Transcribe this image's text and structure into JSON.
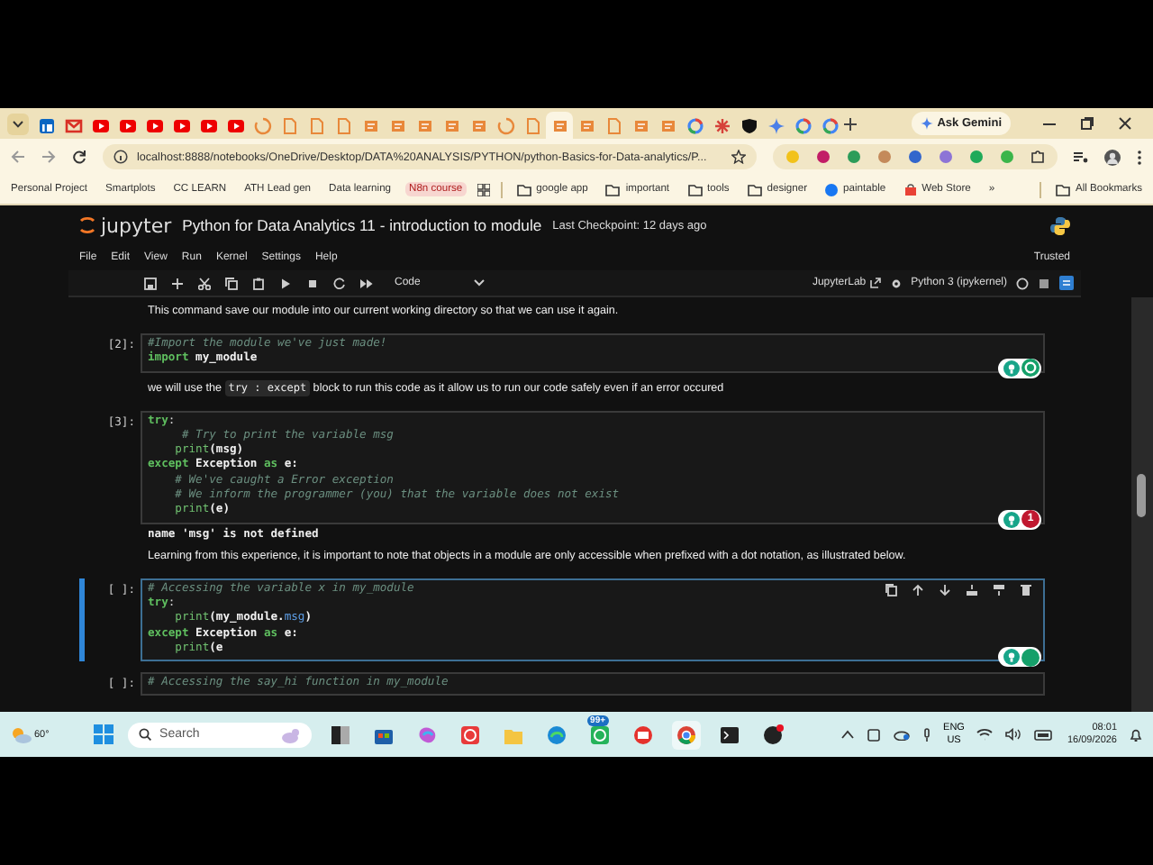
{
  "browser_tabs": [
    {
      "kind": "tile",
      "selected": false
    },
    {
      "kind": "mail",
      "selected": false
    },
    {
      "kind": "video",
      "selected": false
    },
    {
      "kind": "video",
      "selected": false
    },
    {
      "kind": "video",
      "selected": false
    },
    {
      "kind": "video",
      "selected": false
    },
    {
      "kind": "video",
      "selected": false
    },
    {
      "kind": "video",
      "selected": false
    },
    {
      "kind": "spinner",
      "selected": false
    },
    {
      "kind": "page",
      "selected": false
    },
    {
      "kind": "page",
      "selected": false
    },
    {
      "kind": "page",
      "selected": false
    },
    {
      "kind": "notebook",
      "selected": false
    },
    {
      "kind": "notebook",
      "selected": false
    },
    {
      "kind": "notebook",
      "selected": false
    },
    {
      "kind": "notebook",
      "selected": false
    },
    {
      "kind": "notebook",
      "selected": false
    },
    {
      "kind": "spinner",
      "selected": false
    },
    {
      "kind": "page",
      "selected": false
    },
    {
      "kind": "notebook",
      "selected": true
    },
    {
      "kind": "notebook",
      "selected": false
    },
    {
      "kind": "page",
      "selected": false
    },
    {
      "kind": "notebook",
      "selected": false
    },
    {
      "kind": "notebook",
      "selected": false
    },
    {
      "kind": "ring",
      "selected": false
    },
    {
      "kind": "burst",
      "selected": false
    },
    {
      "kind": "shield",
      "selected": false
    },
    {
      "kind": "sparkle",
      "selected": false
    },
    {
      "kind": "ring",
      "selected": false
    },
    {
      "kind": "ring",
      "selected": false
    }
  ],
  "ask_gemini": "Ask Gemini",
  "address_bar": {
    "url": "localhost:8888/notebooks/OneDrive/Desktop/DATA%20ANALYSIS/PYTHON/python-Basics-for-Data-analytics/P..."
  },
  "bookmarks": [
    {
      "label": "Personal Project",
      "kind": "link"
    },
    {
      "label": "Smartplots",
      "kind": "link"
    },
    {
      "label": "CC LEARN",
      "kind": "link"
    },
    {
      "label": "ATH Lead gen",
      "kind": "link"
    },
    {
      "label": "Data learning",
      "kind": "link"
    },
    {
      "label": "N8n course",
      "kind": "highlight"
    },
    {
      "label": "google app",
      "kind": "folder"
    },
    {
      "label": "important",
      "kind": "folder"
    },
    {
      "label": "tools",
      "kind": "folder"
    },
    {
      "label": "designer",
      "kind": "folder"
    },
    {
      "label": "paintable",
      "kind": "site"
    },
    {
      "label": "Web Store",
      "kind": "store"
    }
  ],
  "bookmarks_overflow": "»",
  "all_bookmarks": "All Bookmarks",
  "jupyter": {
    "logo": "jupyter",
    "title": "Python for Data Analytics 11 - introduction to module",
    "checkpoint": "Last Checkpoint: 12 days ago",
    "menu": [
      "File",
      "Edit",
      "View",
      "Run",
      "Kernel",
      "Settings",
      "Help"
    ],
    "trusted": "Trusted",
    "cell_type": "Code",
    "jupyterlab": "JupyterLab",
    "kernel": "Python 3 (ipykernel)"
  },
  "cells": [
    {
      "kind": "markdown",
      "parts": [
        {
          "kind": "text",
          "text": "This command save our module into our current working directory so that we can use it again."
        }
      ]
    },
    {
      "kind": "code",
      "prompt": "[2]:",
      "selected": false,
      "assistant": {
        "kind": "logo"
      },
      "lines": [
        [
          {
            "kind": "comment",
            "text": "#Import the module we've just made!"
          }
        ],
        [
          {
            "kind": "kw",
            "text": "import"
          },
          {
            "kind": "name",
            "text": " my_module"
          }
        ]
      ]
    },
    {
      "kind": "markdown",
      "parts": [
        {
          "kind": "text",
          "text": "we will use the "
        },
        {
          "kind": "code",
          "text": "try : except"
        },
        {
          "kind": "text",
          "text": " block to run this code as it allow us to run our code safely even if an error occured"
        }
      ]
    },
    {
      "kind": "code",
      "prompt": "[3]:",
      "selected": false,
      "assistant": {
        "kind": "count",
        "count": "1"
      },
      "lines": [
        [
          {
            "kind": "kw",
            "text": "try"
          },
          {
            "kind": "plain",
            "text": ":"
          }
        ],
        [
          {
            "kind": "comment",
            "text": "     # Try to print the variable msg"
          }
        ],
        [
          {
            "kind": "fn",
            "text": "    print"
          },
          {
            "kind": "name",
            "text": "(msg)"
          }
        ],
        [
          {
            "kind": "kw",
            "text": "except"
          },
          {
            "kind": "name",
            "text": " Exception "
          },
          {
            "kind": "kw",
            "text": "as"
          },
          {
            "kind": "name",
            "text": " e:"
          }
        ],
        [
          {
            "kind": "comment",
            "text": "    # We've caught a Error exception"
          }
        ],
        [
          {
            "kind": "comment",
            "text": "    # We inform the programmer (you) that the variable does not exist"
          }
        ],
        [
          {
            "kind": "fn",
            "text": "    print"
          },
          {
            "kind": "name",
            "text": "(e)"
          }
        ]
      ]
    },
    {
      "kind": "output",
      "text": "name 'msg' is not defined"
    },
    {
      "kind": "markdown",
      "parts": [
        {
          "kind": "text",
          "text": "Learning from this experience, it is important to note that objects in a module are only accessible when prefixed with a dot notation, as illustrated below."
        }
      ]
    },
    {
      "kind": "code",
      "prompt": "[ ]:",
      "selected": true,
      "assistant": {
        "kind": "idle"
      },
      "lines": [
        [
          {
            "kind": "comment",
            "text": "# Accessing the variable x in my_module"
          }
        ],
        [
          {
            "kind": "kw",
            "text": "try"
          },
          {
            "kind": "plain",
            "text": ":"
          }
        ],
        [
          {
            "kind": "fn",
            "text": "    print"
          },
          {
            "kind": "name",
            "text": "(my_module."
          },
          {
            "kind": "attr",
            "text": "msg"
          },
          {
            "kind": "name",
            "text": ")"
          }
        ],
        [
          {
            "kind": "kw",
            "text": "except"
          },
          {
            "kind": "name",
            "text": " Exception "
          },
          {
            "kind": "kw",
            "text": "as"
          },
          {
            "kind": "name",
            "text": " e:"
          }
        ],
        [
          {
            "kind": "fn",
            "text": "    print"
          },
          {
            "kind": "name",
            "text": "(e"
          }
        ]
      ]
    },
    {
      "kind": "code",
      "prompt": "[ ]:",
      "selected": false,
      "lines": [
        [
          {
            "kind": "comment",
            "text": "# Accessing the say_hi function in my_module"
          }
        ]
      ]
    }
  ],
  "taskbar": {
    "weather": "60°",
    "search_placeholder": "Search",
    "apps": [
      {
        "kind": "window",
        "selected": false
      },
      {
        "kind": "store",
        "selected": false
      },
      {
        "kind": "copilot",
        "selected": false
      },
      {
        "kind": "clock",
        "selected": false
      },
      {
        "kind": "folder",
        "selected": false
      },
      {
        "kind": "edge",
        "selected": false
      },
      {
        "kind": "chat",
        "selected": false,
        "badge": "99+"
      },
      {
        "kind": "office",
        "selected": false
      },
      {
        "kind": "browser",
        "selected": true
      },
      {
        "kind": "terminal",
        "selected": false
      },
      {
        "kind": "dot",
        "selected": false
      }
    ],
    "language": "ENG",
    "region": "US",
    "time": "08:01",
    "date": "16/09/2026"
  }
}
